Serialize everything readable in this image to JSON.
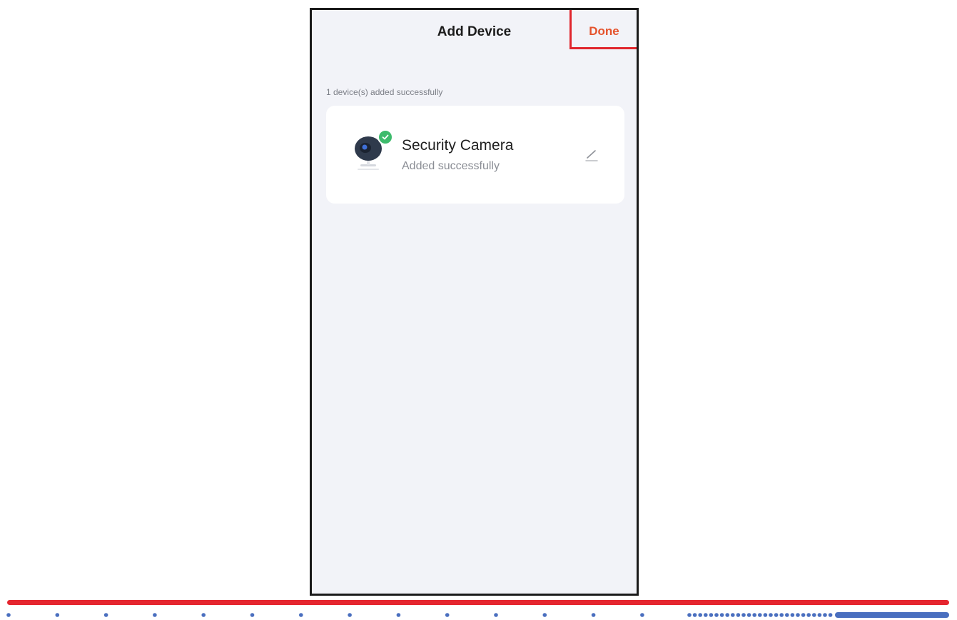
{
  "header": {
    "title": "Add Device",
    "done_label": "Done"
  },
  "section": {
    "caption": "1 device(s) added successfully"
  },
  "device": {
    "name": "Security Camera",
    "status": "Added successfully",
    "icon": "security-camera-icon",
    "badge_icon": "check-icon",
    "action_icon": "pencil-icon"
  },
  "colors": {
    "accent": "#e5532c",
    "highlight_box": "#e0262d",
    "success": "#3dbb6c",
    "background": "#f2f3f8",
    "rule_red": "#e5262f",
    "rule_blue": "#4a6fbf"
  }
}
